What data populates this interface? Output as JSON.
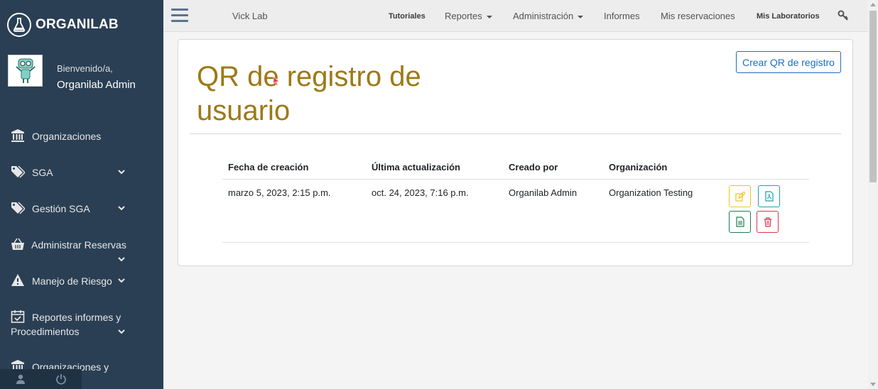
{
  "brand": {
    "name": "ORGANILAB"
  },
  "user": {
    "welcome": "Bienvenido/a,",
    "name": "Organilab Admin"
  },
  "sidebar": {
    "items": [
      {
        "label": "Organizaciones",
        "icon": "institution-icon"
      },
      {
        "label": "SGA",
        "icon": "tags-icon"
      },
      {
        "label": "Gestión SGA",
        "icon": "tags-icon"
      },
      {
        "label": "Administrar Reservas",
        "icon": "basket-icon"
      },
      {
        "label": "Manejo de Riesgo",
        "icon": "warning-icon"
      },
      {
        "label": "Reportes informes y",
        "label2": "Procedimientos",
        "icon": "calendar-check-icon"
      },
      {
        "label": "Organizaciones y",
        "icon": "institution-icon"
      }
    ]
  },
  "topnav": {
    "lab_name": "Vick Lab",
    "items": [
      "Tutoriales",
      "Reportes",
      "Administración",
      "Informes",
      "Mis reservaciones",
      "Mis Laboratorios"
    ]
  },
  "page": {
    "title": "QR de registro de usuario",
    "create_button": "Crear QR de registro"
  },
  "table": {
    "headers": [
      "Fecha de creación",
      "Última actualización",
      "Creado por",
      "Organización"
    ],
    "rows": [
      [
        "marzo 5, 2023, 2:15 p.m.",
        "oct. 24, 2023, 7:16 p.m.",
        "Organilab Admin",
        "Organization Testing"
      ]
    ]
  },
  "colors": {
    "sidebar": "#2a3f54",
    "title": "#9d7918",
    "primary": "#1b6ec2",
    "warning": "#f0c419",
    "info": "#17a2b8",
    "success": "#1e7e50",
    "danger": "#dc3545"
  }
}
